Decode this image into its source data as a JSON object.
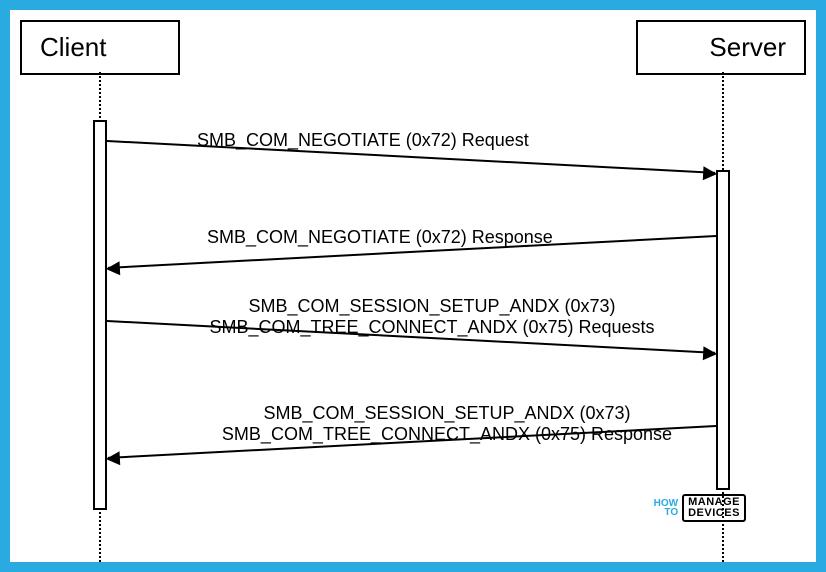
{
  "actors": {
    "client": "Client",
    "server": "Server"
  },
  "messages": {
    "m1": "SMB_COM_NEGOTIATE (0x72) Request",
    "m2": "SMB_COM_NEGOTIATE (0x72) Response",
    "m3a": "SMB_COM_SESSION_SETUP_ANDX (0x73)",
    "m3b": "SMB_COM_TREE_CONNECT_ANDX (0x75) Requests",
    "m4a": "SMB_COM_SESSION_SETUP_ANDX (0x73)",
    "m4b": "SMB_COM_TREE_CONNECT_ANDX (0x75) Response"
  },
  "watermark": {
    "left_top": "HOW",
    "left_bottom": "TO",
    "right_top": "MANAGE",
    "right_bottom": "DEVICES"
  },
  "chart_data": {
    "type": "sequence-diagram",
    "title": "",
    "participants": [
      "Client",
      "Server"
    ],
    "messages": [
      {
        "from": "Client",
        "to": "Server",
        "label": "SMB_COM_NEGOTIATE (0x72) Request"
      },
      {
        "from": "Server",
        "to": "Client",
        "label": "SMB_COM_NEGOTIATE (0x72) Response"
      },
      {
        "from": "Client",
        "to": "Server",
        "label": "SMB_COM_SESSION_SETUP_ANDX (0x73)\nSMB_COM_TREE_CONNECT_ANDX (0x75) Requests"
      },
      {
        "from": "Server",
        "to": "Client",
        "label": "SMB_COM_SESSION_SETUP_ANDX (0x73)\nSMB_COM_TREE_CONNECT_ANDX (0x75) Response"
      }
    ]
  }
}
